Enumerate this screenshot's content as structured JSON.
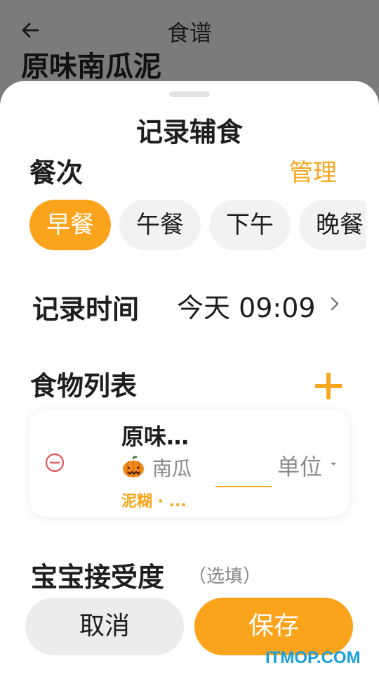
{
  "background_page": {
    "title": "食谱",
    "recipe_title": "原味南瓜泥"
  },
  "sheet": {
    "title": "记录辅食",
    "meal": {
      "label": "餐次",
      "manage_label": "管理",
      "options": [
        "早餐",
        "午餐",
        "下午",
        "晚餐"
      ],
      "selected": "早餐"
    },
    "record_time": {
      "label": "记录时间",
      "value": "今天 09:09"
    },
    "food_list": {
      "label": "食物列表",
      "items": [
        {
          "name": "原味…",
          "ingredient": "南瓜",
          "ingredient_icon": "pumpkin-icon",
          "tag": "泥糊 · ...",
          "amount": "",
          "unit": "单位"
        }
      ]
    },
    "acceptance": {
      "label": "宝宝接受度",
      "optional_note": "（选填）"
    },
    "buttons": {
      "cancel": "取消",
      "save": "保存"
    }
  },
  "watermark": "ITMOP.COM",
  "colors": {
    "accent": "#fca31c",
    "accent_text": "#f7a71c",
    "remove": "#e05555",
    "overlay": "#7b7b7b"
  }
}
